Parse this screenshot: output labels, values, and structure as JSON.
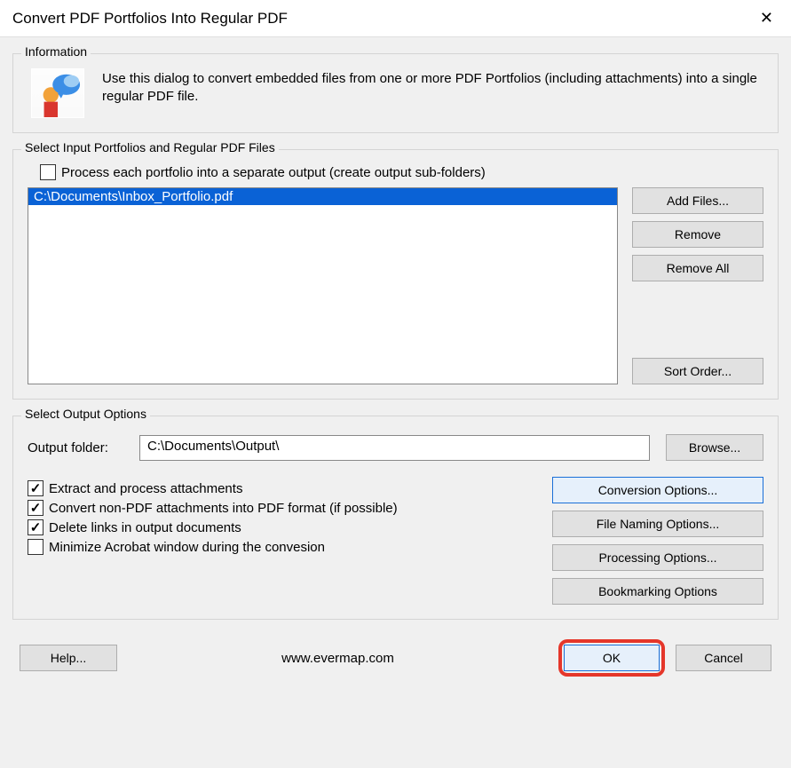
{
  "window": {
    "title": "Convert PDF Portfolios Into Regular PDF"
  },
  "info": {
    "legend": "Information",
    "text": "Use this dialog to convert embedded files from one or more PDF Portfolios (including attachments) into a single regular PDF file."
  },
  "input_section": {
    "legend": "Select Input Portfolios and Regular PDF Files",
    "process_separate_label": "Process each portfolio into a separate output (create output sub-folders)",
    "process_separate_checked": false,
    "files": [
      "C:\\Documents\\Inbox_Portfolio.pdf"
    ],
    "buttons": {
      "add_files": "Add Files...",
      "remove": "Remove",
      "remove_all": "Remove All",
      "sort_order": "Sort Order..."
    }
  },
  "output_section": {
    "legend": "Select Output Options",
    "output_folder_label": "Output folder:",
    "output_folder_value": "C:\\Documents\\Output\\",
    "browse": "Browse...",
    "checks": {
      "extract_label": "Extract and process attachments",
      "extract_checked": true,
      "convert_label": "Convert non-PDF attachments into PDF format (if possible)",
      "convert_checked": true,
      "delete_links_label": "Delete links in output documents",
      "delete_links_checked": true,
      "minimize_label": "Minimize Acrobat window during the convesion",
      "minimize_checked": false
    },
    "buttons": {
      "conversion": "Conversion Options...",
      "naming": "File Naming Options...",
      "processing": "Processing Options...",
      "bookmarking": "Bookmarking Options"
    }
  },
  "footer": {
    "help": "Help...",
    "url": "www.evermap.com",
    "ok": "OK",
    "cancel": "Cancel"
  }
}
